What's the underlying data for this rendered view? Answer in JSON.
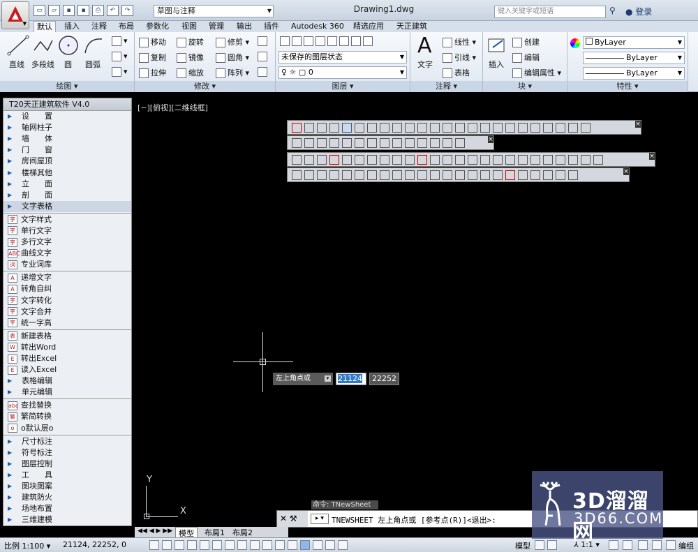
{
  "titlebar": {
    "workspace": "草图与注释",
    "document": "Drawing1.dwg",
    "search_placeholder": "键入关键字或短语",
    "login": "登录"
  },
  "tabs": [
    "默认",
    "插入",
    "注释",
    "布局",
    "参数化",
    "视图",
    "管理",
    "输出",
    "插件",
    "Autodesk 360",
    "精选应用",
    "天正建筑"
  ],
  "ribbon": {
    "draw": {
      "title": "绘图",
      "line": "直线",
      "polyline": "多段线",
      "circle": "圆",
      "arc": "圆弧"
    },
    "modify": {
      "title": "修改",
      "move": "移动",
      "rotate": "旋转",
      "trim": "修剪",
      "copy": "复制",
      "mirror": "镜像",
      "fillet": "圆角",
      "stretch": "拉伸",
      "scale": "缩放",
      "array": "阵列"
    },
    "layers": {
      "title": "图层",
      "state": "未保存的图层状态",
      "current": "0"
    },
    "annotation": {
      "title": "注释",
      "text": "文字",
      "linear": "线性",
      "leader": "引线",
      "table": "表格"
    },
    "block": {
      "title": "块",
      "insert": "插入",
      "create": "创建",
      "edit": "编辑",
      "attr": "编辑属性"
    },
    "props": {
      "title": "特性",
      "color": "ByLayer",
      "linetype": "ByLayer",
      "lineweight": "ByLayer"
    }
  },
  "palette": {
    "title": "T20天正建筑软件 V4.0",
    "groups": [
      [
        {
          "t": "tri",
          "l": "设　　置"
        },
        {
          "t": "tri",
          "l": "轴网柱子"
        },
        {
          "t": "tri",
          "l": "墙　　体"
        },
        {
          "t": "tri",
          "l": "门　　窗"
        },
        {
          "t": "tri",
          "l": "房间屋顶"
        },
        {
          "t": "tri",
          "l": "楼梯其他"
        },
        {
          "t": "tri",
          "l": "立　　面"
        },
        {
          "t": "tri",
          "l": "剖　　面"
        },
        {
          "t": "tri",
          "l": "文字表格",
          "sel": true
        }
      ],
      [
        {
          "t": "ico",
          "i": "字",
          "l": "文字样式"
        },
        {
          "t": "ico",
          "i": "字",
          "l": "单行文字"
        },
        {
          "t": "ico",
          "i": "字",
          "l": "多行文字"
        },
        {
          "t": "ico",
          "i": "ABC",
          "l": "曲线文字"
        },
        {
          "t": "ico",
          "i": "词",
          "l": "专业词库"
        }
      ],
      [
        {
          "t": "ico",
          "i": "A",
          "l": "递增文字"
        },
        {
          "t": "ico",
          "i": "A",
          "l": "转角自纠"
        },
        {
          "t": "ico",
          "i": "字",
          "l": "文字转化"
        },
        {
          "t": "ico",
          "i": "字",
          "l": "文字合并"
        },
        {
          "t": "ico",
          "i": "字",
          "l": "统一字高"
        }
      ],
      [
        {
          "t": "ico",
          "i": "表",
          "l": "新建表格"
        },
        {
          "t": "ico",
          "i": "W",
          "l": "转出Word"
        },
        {
          "t": "ico",
          "i": "E",
          "l": "转出Excel"
        },
        {
          "t": "ico",
          "i": "E",
          "l": "读入Excel"
        },
        {
          "t": "tri",
          "l": "表格编辑"
        },
        {
          "t": "tri",
          "l": "单元编辑"
        }
      ],
      [
        {
          "t": "ico",
          "i": "abc",
          "l": "查找替换"
        },
        {
          "t": "ico",
          "i": "繁",
          "l": "繁简转换"
        },
        {
          "t": "ico",
          "i": "o",
          "l": "o默认层o"
        }
      ],
      [
        {
          "t": "tri",
          "l": "尺寸标注"
        },
        {
          "t": "tri",
          "l": "符号标注"
        },
        {
          "t": "tri",
          "l": "图层控制"
        },
        {
          "t": "tri",
          "l": "工　　具"
        },
        {
          "t": "tri",
          "l": "图块图案"
        },
        {
          "t": "tri",
          "l": "建筑防火"
        },
        {
          "t": "tri",
          "l": "场地布置"
        },
        {
          "t": "tri",
          "l": "三维建模"
        }
      ]
    ]
  },
  "viewport": {
    "label": "[−][俯视][二维线框]"
  },
  "dynamic_input": {
    "prompt": "左上角点或",
    "x": "21124",
    "y": "22252"
  },
  "ucs": {
    "x": "X",
    "y": "Y"
  },
  "command": {
    "history": "命令: TNewSheet",
    "current": "TNEWSHEET 左上角点或 [参考点(R)]<退出>:"
  },
  "layout_tabs": [
    "模型",
    "布局1",
    "布局2"
  ],
  "status": {
    "scale": "比例 1:100",
    "coords": "21124, 22252, 0",
    "model": "模型",
    "anno_scale": "1:1",
    "workspace": "编组"
  },
  "watermark": {
    "line1": "3D溜溜网",
    "line2": "3D66.COM"
  }
}
